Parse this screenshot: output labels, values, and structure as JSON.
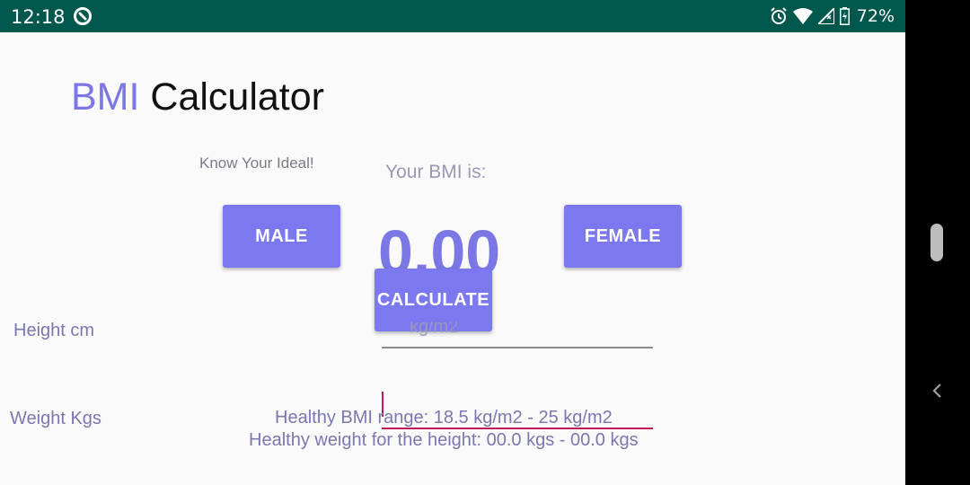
{
  "status_bar": {
    "time": "12:18",
    "battery_percent": "72%",
    "icons": [
      "app-notification-icon",
      "alarm-icon",
      "wifi-icon",
      "cellular-signal-icon",
      "battery-icon"
    ]
  },
  "app": {
    "title_accent": "BMI",
    "title_rest": " Calculator",
    "tagline": "Know Your Ideal!",
    "bmi_caption": "Your BMI is:",
    "bmi_value": "0.00",
    "bmi_unit": "kg/m2"
  },
  "buttons": {
    "male": "MALE",
    "female": "FEMALE",
    "calculate": "CALCULATE"
  },
  "inputs": {
    "height_label": "Height cm",
    "weight_label": "Weight Kgs",
    "height_value": "",
    "weight_value": ""
  },
  "results": {
    "healthy_range": "Healthy BMI range: 18.5 kg/m2 - 25 kg/m2",
    "healthy_weight": "Healthy weight for the height: 00.0 kgs - 00.0 kgs"
  },
  "colors": {
    "status_bar": "#00574b",
    "accent": "#7b78e6",
    "button": "#7b78f0",
    "focus_line": "#c2185b"
  }
}
